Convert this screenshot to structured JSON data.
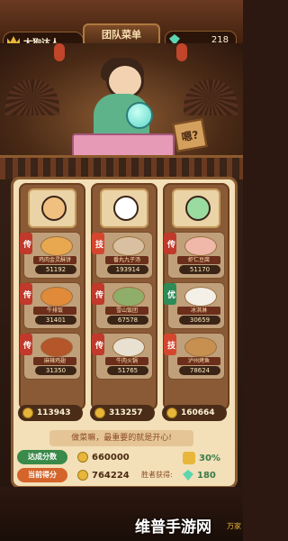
{
  "header": {
    "player_name": "太狗达人",
    "title": "团队菜单",
    "gem_count": "218"
  },
  "scene": {
    "sign_text": "嗯?"
  },
  "columns": [
    {
      "dishes": [
        {
          "tag": "传",
          "name": "鸡肉金灵酥饼",
          "value": "51192"
        },
        {
          "tag": "传",
          "name": "牛排饭",
          "value": "31401"
        },
        {
          "tag": "传",
          "name": "麻辣鸡翅",
          "value": "31350"
        }
      ],
      "total": "113943"
    },
    {
      "dishes": [
        {
          "tag": "技",
          "name": "番丸九子汤",
          "value": "193914"
        },
        {
          "tag": "传",
          "name": "雪山饭团",
          "value": "67578"
        },
        {
          "tag": "传",
          "name": "牛肉火锅",
          "value": "51765"
        }
      ],
      "total": "313257"
    },
    {
      "dishes": [
        {
          "tag": "传",
          "name": "虾仁豆腐",
          "value": "51170"
        },
        {
          "tag": "优",
          "name": "冰淇淋",
          "value": "30659"
        },
        {
          "tag": "技",
          "name": "泸州烤鱼",
          "value": "78624"
        }
      ],
      "total": "160664"
    }
  ],
  "banner_text": "做菜嘛，最重要的就是开心!",
  "summary": {
    "target_label": "达成分数",
    "target_value": "660000",
    "target_percent": "30%",
    "current_label": "当前得分",
    "current_value": "764224",
    "reward_label": "胜者获得:",
    "reward_value": "180"
  },
  "watermark": {
    "text": "维普手游网",
    "logo": "万家"
  }
}
